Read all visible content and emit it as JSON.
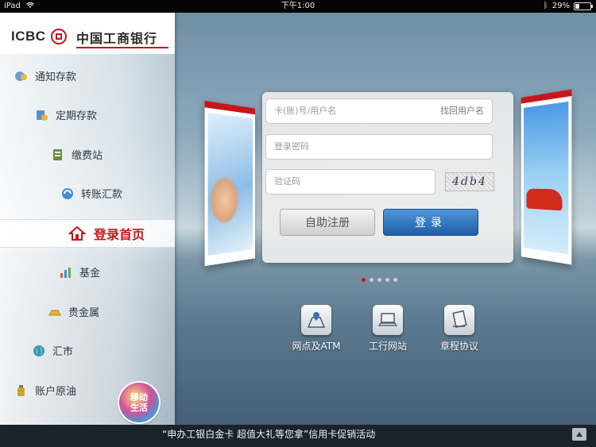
{
  "status": {
    "device": "iPad",
    "time": "下午1:00",
    "battery": "29%"
  },
  "logo": {
    "brand": "ICBC",
    "name_cn": "中国工商银行"
  },
  "sidebar": {
    "items": [
      {
        "label": "通知存款",
        "icon": "deposit-notice-icon"
      },
      {
        "label": "定期存款",
        "icon": "fixed-deposit-icon"
      },
      {
        "label": "缴费站",
        "icon": "payment-icon"
      },
      {
        "label": "转账汇款",
        "icon": "transfer-icon"
      },
      {
        "label": "登录首页",
        "icon": "home-icon"
      },
      {
        "label": "基金",
        "icon": "fund-chart-icon"
      },
      {
        "label": "贵金属",
        "icon": "gold-bar-icon"
      },
      {
        "label": "汇市",
        "icon": "forex-globe-icon"
      },
      {
        "label": "账户原油",
        "icon": "oil-bottle-icon"
      }
    ],
    "active": "登录首页",
    "mobile_life": "移动生活"
  },
  "login": {
    "account_placeholder": "卡(账)号/用户名",
    "find_username": "找回用户名",
    "password_placeholder": "登录密码",
    "captcha_placeholder": "验证码",
    "captcha_code": "4db4",
    "register_label": "自助注册",
    "login_label": "登录"
  },
  "carousel": {
    "pages": 5,
    "current": 1
  },
  "quick_links": [
    {
      "label": "网点及ATM",
      "icon": "map-pin-icon"
    },
    {
      "label": "工行网站",
      "icon": "laptop-icon"
    },
    {
      "label": "章程协议",
      "icon": "document-icon"
    }
  ],
  "ticker": {
    "message": "“申办工银白金卡 超值大礼等您拿”信用卡促销活动"
  },
  "colors": {
    "brand_red": "#c8161d",
    "login_blue": "#2f74bd"
  }
}
